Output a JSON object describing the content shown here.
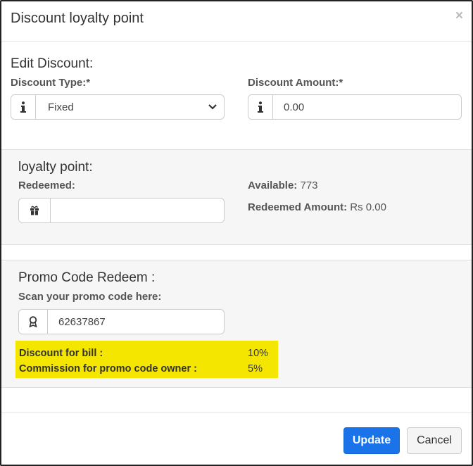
{
  "modal": {
    "title": "Discount loyalty point",
    "close_label": "×"
  },
  "edit_discount": {
    "heading": "Edit Discount:",
    "type_label": "Discount Type:*",
    "type_value": "Fixed",
    "amount_label": "Discount Amount:*",
    "amount_value": "0.00"
  },
  "loyalty": {
    "heading": "loyalty point:",
    "redeemed_label": "Redeemed:",
    "redeemed_value": "",
    "available_label": "Available:",
    "available_value": "773",
    "redeemed_amount_label": "Redeemed Amount:",
    "redeemed_amount_value": "Rs 0.00"
  },
  "promo": {
    "heading": "Promo Code Redeem :",
    "scan_label": "Scan your promo code here:",
    "code_value": "62637867",
    "discount_label": "Discount for bill :",
    "discount_value": "10%",
    "commission_label": "Commission for promo code owner :",
    "commission_value": "5%"
  },
  "footer": {
    "update_label": "Update",
    "cancel_label": "Cancel"
  },
  "colors": {
    "primary": "#1a73e8",
    "highlight": "#f5e600"
  },
  "icons": [
    "info-icon",
    "chevron-down-icon",
    "gift-icon",
    "award-icon",
    "close-icon"
  ]
}
